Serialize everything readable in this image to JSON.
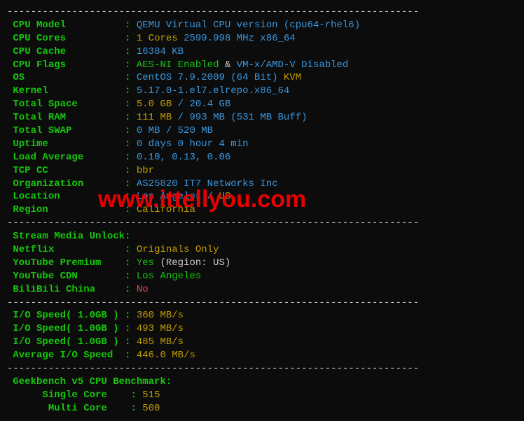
{
  "dashes": "----------------------------------------------------------------------",
  "labels": {
    "cpu_model": "CPU Model",
    "cpu_cores": "CPU Cores",
    "cpu_cache": "CPU Cache",
    "cpu_flags": "CPU Flags",
    "os": "OS",
    "kernel": "Kernel",
    "total_space": "Total Space",
    "total_ram": "Total RAM",
    "total_swap": "Total SWAP",
    "uptime": "Uptime",
    "load_average": "Load Average",
    "tcp_cc": "TCP CC",
    "organization": "Organization",
    "location": "Location",
    "region": "Region",
    "stream_media": "Stream Media Unlock",
    "netflix": "Netflix",
    "youtube_premium": "YouTube Premium",
    "youtube_cdn": "YouTube CDN",
    "bilibili": "BiliBili China",
    "io_speed": "I/O Speed( 1.0GB )",
    "avg_io": "Average I/O Speed",
    "geekbench": "Geekbench v5 CPU Benchmark:",
    "single_core": "Single Core",
    "multi_core": "Multi Core"
  },
  "values": {
    "cpu_model": "QEMU Virtual CPU version (cpu64-rhel6)",
    "cpu_cores_n": "1 Cores",
    "cpu_cores_rest": " 2599.998 MHz x86_64",
    "cpu_cache": "16384 KB",
    "cpu_flags_a": "AES-NI Enabled",
    "cpu_flags_amp": " & ",
    "cpu_flags_b": "VM-x/AMD-V Disabled",
    "os_a": "CentOS 7.9.2009 (64 Bit)",
    "os_b": " KVM",
    "kernel": "5.17.0-1.el7.elrepo.x86_64",
    "space_a": "5.0 GB",
    "space_sep": " / ",
    "space_b": "20.4 GB",
    "ram_a": "111 MB",
    "ram_sep": " / ",
    "ram_b": "993 MB",
    "ram_buff": " (531 MB Buff)",
    "swap": "0 MB / 520 MB",
    "uptime": "0 days 0 hour 4 min",
    "load": "0.10, 0.13, 0.06",
    "tcp_cc": "bbr",
    "org": "AS25820 IT7 Networks Inc",
    "loc_a": "Los Angeles",
    "loc_sep": " / ",
    "loc_b": "US",
    "region": "California",
    "netflix": "Originals Only",
    "ytp_a": "Yes ",
    "ytp_b": "(Region: US)",
    "yt_cdn": "Los Angeles",
    "bilibili": "No",
    "io1": "360 MB/s",
    "io2": "493 MB/s",
    "io3": "485 MB/s",
    "avg_io": "446.0 MB/s",
    "single_core": "515",
    "multi_core": "500"
  },
  "watermark": "www.ittellyou.com"
}
